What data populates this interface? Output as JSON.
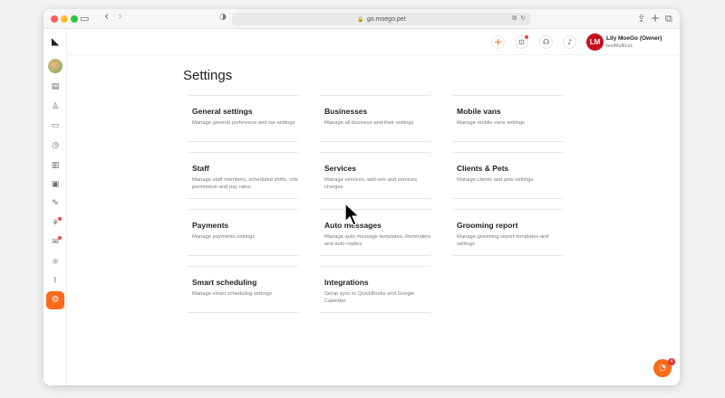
{
  "browser": {
    "url": "go.moego.pet",
    "icons": {
      "sidebar_toggle": "▭",
      "back": "‹",
      "forward": "›",
      "shield": "◑",
      "lock": "🔒",
      "translate": "⧉",
      "reload": "↻",
      "share": "⇪",
      "new_tab": "+",
      "tabs": "⧉"
    }
  },
  "topbar": {
    "user_initials": "LM",
    "user_name": "Lily MoeGo (Owner)",
    "business_name": "testMultiLoc",
    "icons": {
      "add": "+",
      "calendar_badge": "⊡",
      "headset": "☊",
      "bell": "♪",
      "chevron": "⌄"
    }
  },
  "sidebar": {
    "logo": "◣",
    "icons": [
      "▤",
      "♙",
      "▭",
      "◷",
      "▥",
      "▣",
      "✎",
      "⚘",
      "✉",
      "⚛",
      "⌇"
    ],
    "active_icon": "⚙"
  },
  "page": {
    "title": "Settings",
    "cards": [
      {
        "title": "General settings",
        "desc": "Manage general preference and tax settings"
      },
      {
        "title": "Businesses",
        "desc": "Manage all business and their settings"
      },
      {
        "title": "Mobile vans",
        "desc": "Manage mobile vans settings"
      },
      {
        "title": "Staff",
        "desc": "Manage staff members, scheduled shifts, role permission and pay rates"
      },
      {
        "title": "Services",
        "desc": "Manage services, add-ons and services charges"
      },
      {
        "title": "Clients & Pets",
        "desc": "Manage clients and pets settings"
      },
      {
        "title": "Payments",
        "desc": "Manage payments settings"
      },
      {
        "title": "Auto messages",
        "desc": "Manage auto message templates, Reminders and auto replies"
      },
      {
        "title": "Grooming report",
        "desc": "Manage grooming report templates and settings"
      },
      {
        "title": "Smart scheduling",
        "desc": "Manage smart scheduling settings"
      },
      {
        "title": "Integrations",
        "desc": "Setup sync to QuickBooks and Google Calendar"
      }
    ]
  },
  "chat": {
    "icon": "◔",
    "badge": "4"
  },
  "colors": {
    "accent": "#f96b18",
    "avatar": "#c8101f"
  }
}
